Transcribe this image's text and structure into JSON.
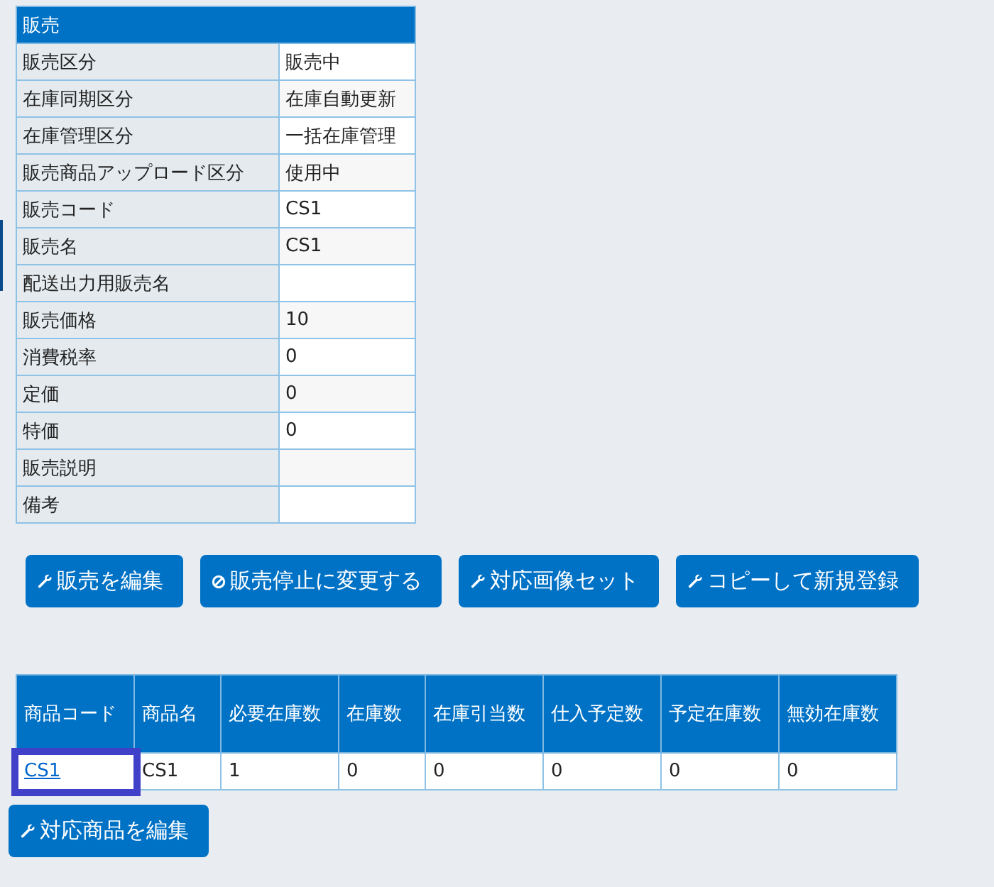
{
  "detail_table": {
    "title": "販売",
    "rows": [
      {
        "label": "販売区分",
        "value": "販売中"
      },
      {
        "label": "在庫同期区分",
        "value": "在庫自動更新"
      },
      {
        "label": "在庫管理区分",
        "value": "一括在庫管理"
      },
      {
        "label": "販売商品アップロード区分",
        "value": "使用中"
      },
      {
        "label": "販売コード",
        "value": "CS1"
      },
      {
        "label": "販売名",
        "value": "CS1"
      },
      {
        "label": "配送出力用販売名",
        "value": ""
      },
      {
        "label": "販売価格",
        "value": "10"
      },
      {
        "label": "消費税率",
        "value": "0"
      },
      {
        "label": "定価",
        "value": "0"
      },
      {
        "label": "特価",
        "value": "0"
      },
      {
        "label": "販売説明",
        "value": ""
      },
      {
        "label": "備考",
        "value": ""
      }
    ]
  },
  "actions": [
    {
      "label": "販売を編集",
      "kind": "wrench"
    },
    {
      "label": "販売停止に変更する",
      "kind": "ban"
    },
    {
      "label": "対応画像セット",
      "kind": "wrench"
    },
    {
      "label": "コピーして新規登録",
      "kind": "wrench"
    }
  ],
  "products_table": {
    "columns": [
      "商品コード",
      "商品名",
      "必要在庫数",
      "在庫数",
      "在庫引当数",
      "仕入予定数",
      "予定在庫数",
      "無効在庫数"
    ],
    "rows": [
      {
        "cells": [
          "CS1",
          "CS1",
          "1",
          "0",
          "0",
          "0",
          "0",
          "0"
        ],
        "highlighted": true
      }
    ]
  },
  "edit_products_button": {
    "label": "対応商品を編集",
    "kind": "wrench"
  }
}
